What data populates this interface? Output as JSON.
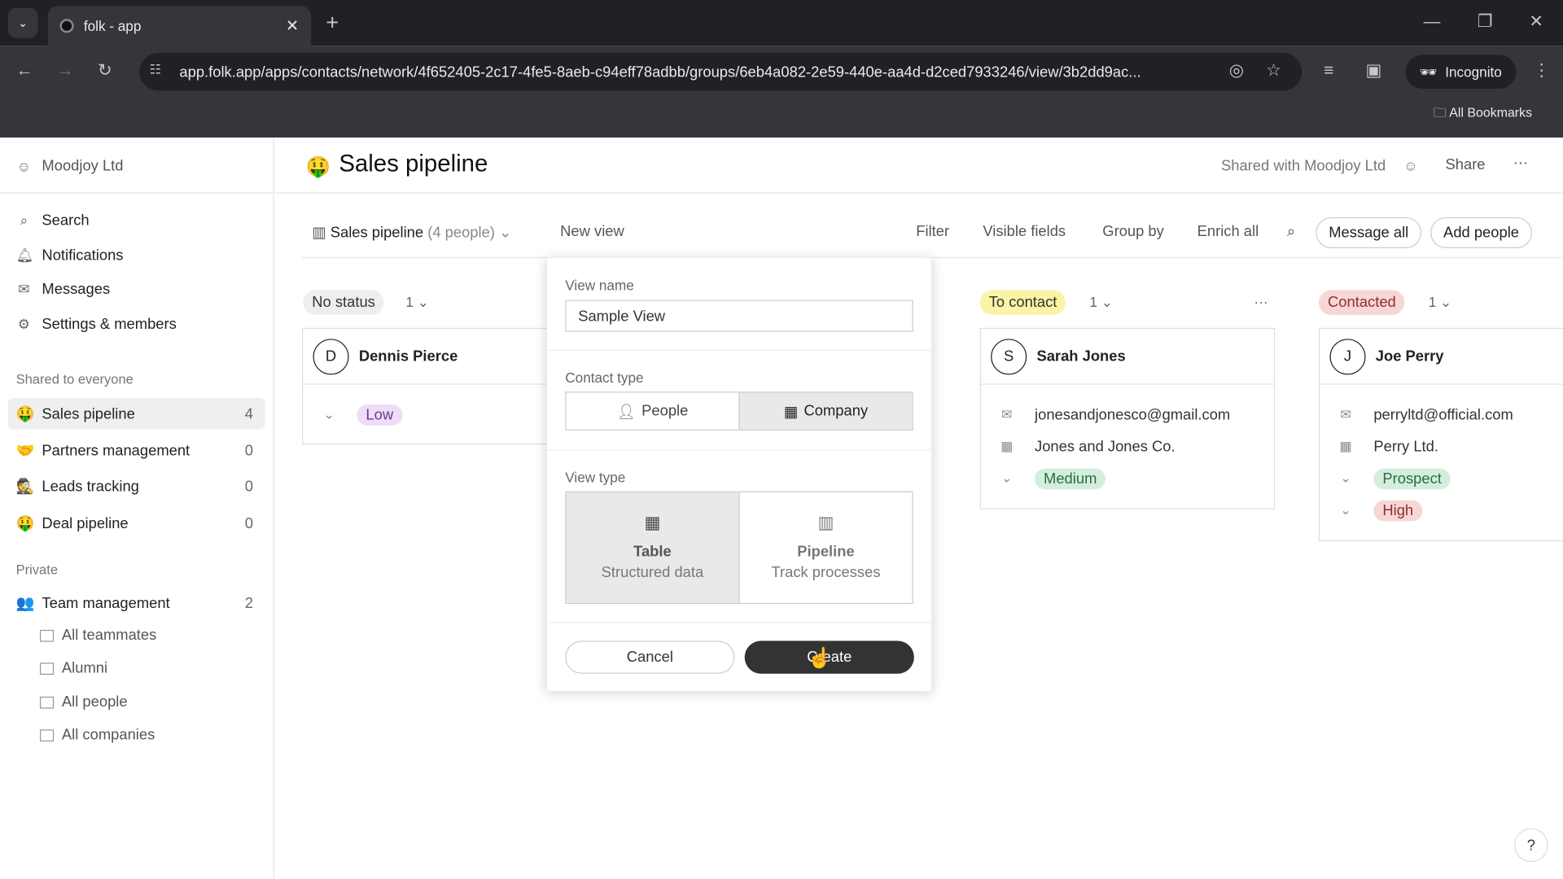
{
  "browser": {
    "tab_title": "folk - app",
    "url": "app.folk.app/apps/contacts/network/4f652405-2c17-4fe5-8aeb-c94eff78adbb/groups/6eb4a082-2e59-440e-aa4d-d2ced7933246/view/3b2dd9ac...",
    "incognito_label": "Incognito",
    "bookmarks_label": "All Bookmarks"
  },
  "sidebar": {
    "workspace": "Moodjoy Ltd",
    "nav": [
      {
        "label": "Search",
        "icon": "search-icon"
      },
      {
        "label": "Notifications",
        "icon": "bell-icon"
      },
      {
        "label": "Messages",
        "icon": "mail-icon"
      },
      {
        "label": "Settings & members",
        "icon": "gear-icon"
      }
    ],
    "shared_title": "Shared to everyone",
    "shared": [
      {
        "emoji": "🤑",
        "label": "Sales pipeline",
        "count": "4"
      },
      {
        "emoji": "🤝",
        "label": "Partners management",
        "count": "0"
      },
      {
        "emoji": "🕵",
        "label": "Leads tracking",
        "count": "0"
      },
      {
        "emoji": "🤑",
        "label": "Deal pipeline",
        "count": "0"
      }
    ],
    "private_title": "Private",
    "private_group": {
      "emoji": "👥",
      "label": "Team management",
      "count": "2"
    },
    "private_views": [
      "All teammates",
      "Alumni",
      "All people",
      "All companies"
    ]
  },
  "header": {
    "emoji": "🤑",
    "title": "Sales pipeline",
    "shared_with": "Shared with Moodjoy Ltd",
    "share": "Share",
    "more": "···"
  },
  "toolbar": {
    "view_name": "Sales pipeline",
    "view_count": "(4 people)",
    "new_view": "New view",
    "filter": "Filter",
    "visible_fields": "Visible fields",
    "group_by": "Group by",
    "enrich_all": "Enrich all",
    "message_all": "Message all",
    "add_people": "Add people"
  },
  "columns": [
    {
      "status": "No status",
      "count": "1",
      "color": "#eeeeee",
      "cards": [
        {
          "initial": "D",
          "name": "Dennis Pierce",
          "tags": [
            {
              "label": "Low",
              "bg": "#eedcf8",
              "fg": "#6a3c86"
            }
          ]
        }
      ]
    },
    {
      "status": "To contact",
      "count": "1",
      "color": "#fbf3a6",
      "cards": [
        {
          "initial": "S",
          "name": "Sarah Jones",
          "email": "jonesandjonesco@gmail.com",
          "company": "Jones and Jones Co.",
          "tags": [
            {
              "label": "Medium",
              "bg": "#d4eedd",
              "fg": "#2d6b45"
            }
          ]
        }
      ]
    },
    {
      "status": "Contacted",
      "count": "1",
      "color": "#f8d6d6",
      "cards": [
        {
          "initial": "J",
          "name": "Joe Perry",
          "email": "perryltd@official.com",
          "company": "Perry Ltd.",
          "tags": [
            {
              "label": "Prospect",
              "bg": "#d4eedd",
              "fg": "#2d6b45"
            },
            {
              "label": "High",
              "bg": "#f8d6d6",
              "fg": "#8a3030"
            }
          ]
        }
      ]
    }
  ],
  "modal": {
    "view_name_label": "View name",
    "view_name_value": "Sample View",
    "contact_type_label": "Contact type",
    "contact_people": "People",
    "contact_company": "Company",
    "contact_selected": "Company",
    "view_type_label": "View type",
    "table_title": "Table",
    "table_desc": "Structured data",
    "pipeline_title": "Pipeline",
    "pipeline_desc": "Track processes",
    "view_type_selected": "Table",
    "cancel": "Cancel",
    "create": "Create"
  },
  "help": "?"
}
